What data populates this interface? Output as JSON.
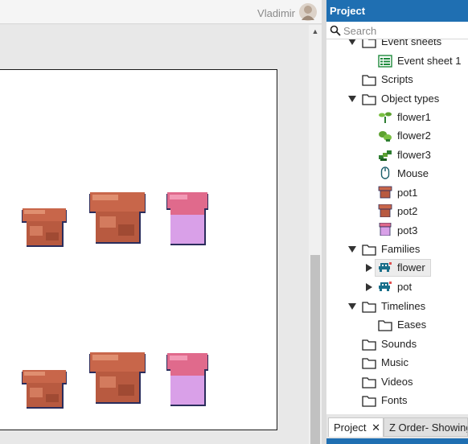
{
  "user": {
    "name": "Vladimir"
  },
  "panel": {
    "title": "Project",
    "search_placeholder": "Search"
  },
  "tree": [
    {
      "label": "Event sheets",
      "icon": "folder-icon"
    },
    {
      "label": "Event sheet 1",
      "icon": "event-sheet-icon"
    },
    {
      "label": "Scripts",
      "icon": "folder-icon"
    },
    {
      "label": "Object types",
      "icon": "folder-icon"
    },
    {
      "label": "flower1",
      "icon": "flower1-icon"
    },
    {
      "label": "flower2",
      "icon": "flower2-icon"
    },
    {
      "label": "flower3",
      "icon": "flower3-icon"
    },
    {
      "label": "Mouse",
      "icon": "mouse-icon"
    },
    {
      "label": "pot1",
      "icon": "pot1-icon"
    },
    {
      "label": "pot2",
      "icon": "pot2-icon"
    },
    {
      "label": "pot3",
      "icon": "pot3-icon"
    },
    {
      "label": "Families",
      "icon": "folder-icon"
    },
    {
      "label": "flower",
      "icon": "family-icon"
    },
    {
      "label": "pot",
      "icon": "family-icon"
    },
    {
      "label": "Timelines",
      "icon": "folder-icon"
    },
    {
      "label": "Eases",
      "icon": "folder-icon"
    },
    {
      "label": "Sounds",
      "icon": "folder-icon"
    },
    {
      "label": "Music",
      "icon": "folder-icon"
    },
    {
      "label": "Videos",
      "icon": "folder-icon"
    },
    {
      "label": "Fonts",
      "icon": "folder-icon"
    }
  ],
  "tabs": {
    "project": "Project",
    "zorder": "Z Order- Showing"
  },
  "colors": {
    "accent": "#1f6fb2",
    "pot_terracotta": "#c8664a",
    "pot_pink": "#d9a0e8"
  }
}
